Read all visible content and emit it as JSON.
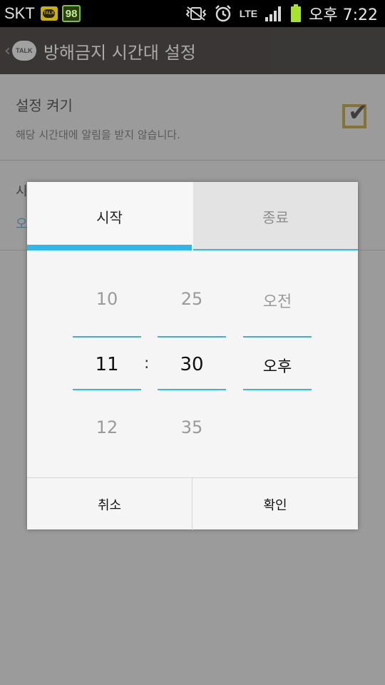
{
  "status_bar": {
    "carrier": "SKT",
    "notification_badge": "98",
    "network": "LTE",
    "time": "오후 7:22",
    "talk_badge_text": "TALK",
    "battery_color": "#a6e22e"
  },
  "action_bar": {
    "title": "방해금지 시간대 설정",
    "logo_text": "TALK"
  },
  "settings": {
    "enable": {
      "title": "설정 켜기",
      "subtitle": "해당 시간대에 알림을 받지 않습니다.",
      "checked": true
    },
    "row2": {
      "title_partial": "시",
      "value_partial": "오"
    }
  },
  "dialog": {
    "tabs": [
      {
        "label": "시작",
        "selected": true
      },
      {
        "label": "종료",
        "selected": false
      }
    ],
    "picker": {
      "hour": {
        "prev": "10",
        "current": "11",
        "next": "12"
      },
      "separator": ":",
      "minute": {
        "prev": "25",
        "current": "30",
        "next": "35"
      },
      "ampm": {
        "prev": "오전",
        "current": "오후",
        "next": ""
      }
    },
    "buttons": {
      "cancel": "취소",
      "ok": "확인"
    }
  },
  "colors": {
    "accent": "#33b5e5",
    "checkbox": "#b58f00",
    "action_bar": "#1c1615"
  }
}
